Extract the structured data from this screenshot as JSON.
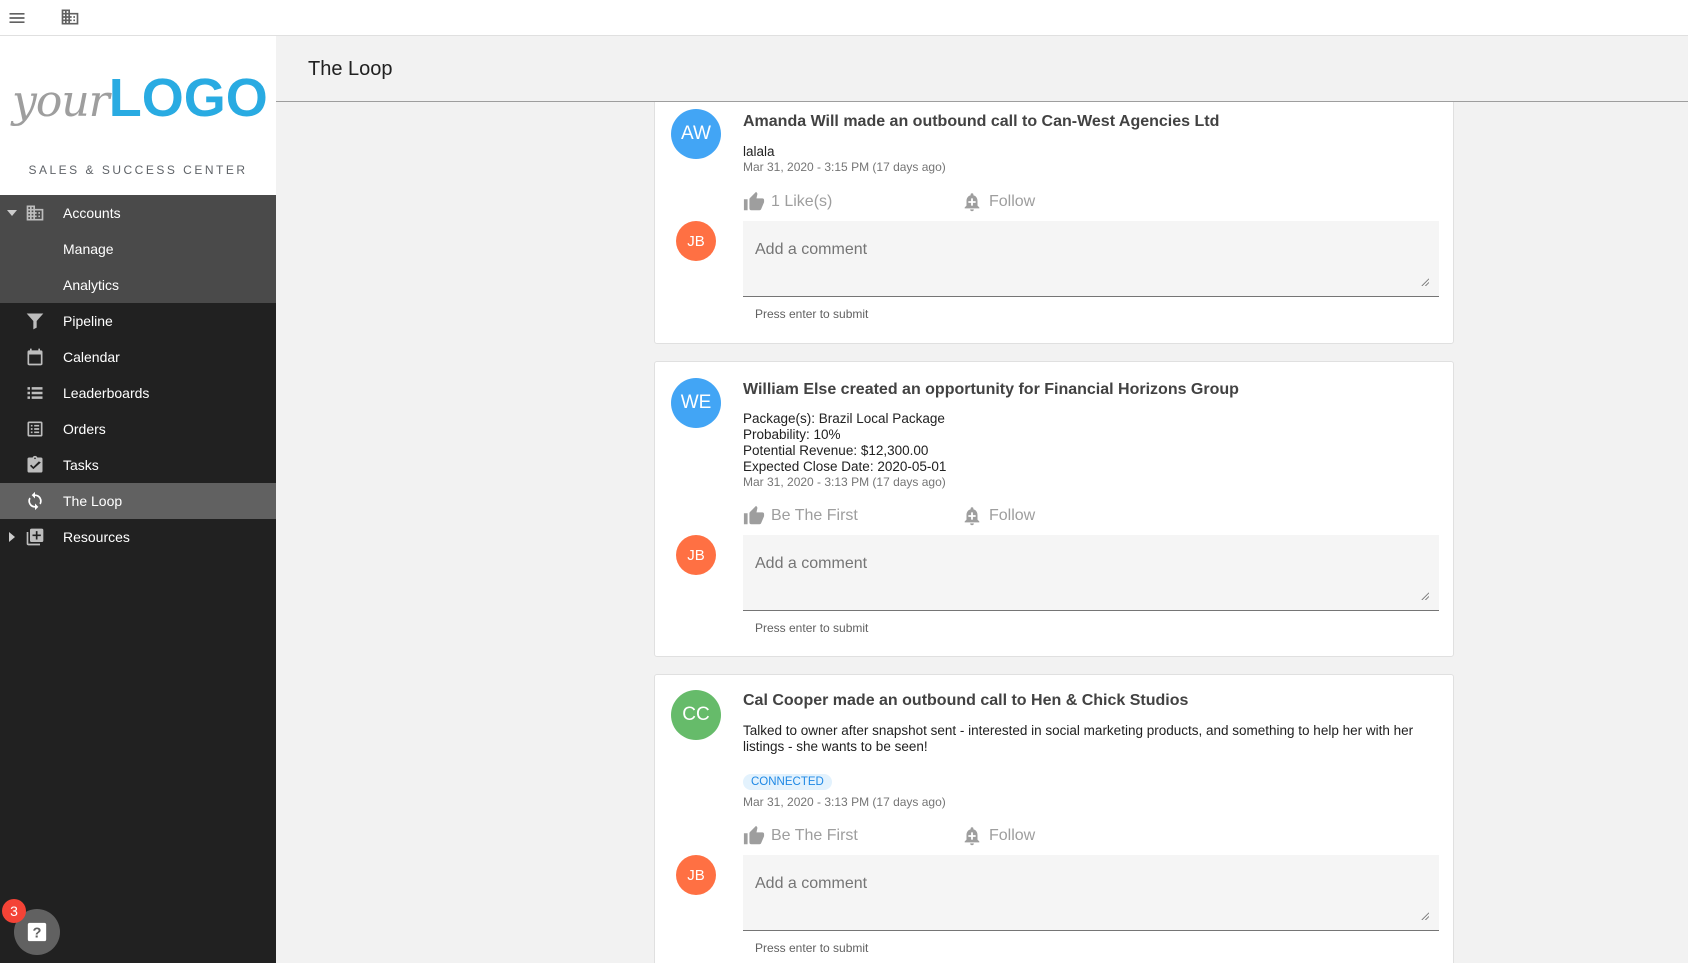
{
  "app": {
    "logo_your": "your",
    "logo_logo": "LOGO",
    "tagline": "SALES & SUCCESS CENTER"
  },
  "sidebar": {
    "items": [
      {
        "label": "Accounts",
        "icon": "building-icon"
      },
      {
        "label": "Manage"
      },
      {
        "label": "Analytics"
      },
      {
        "label": "Pipeline",
        "icon": "funnel-icon"
      },
      {
        "label": "Calendar",
        "icon": "calendar-icon"
      },
      {
        "label": "Leaderboards",
        "icon": "list-icon"
      },
      {
        "label": "Orders",
        "icon": "orders-icon"
      },
      {
        "label": "Tasks",
        "icon": "clipboard-check-icon"
      },
      {
        "label": "The Loop",
        "icon": "sync-icon"
      },
      {
        "label": "Resources",
        "icon": "library-icon"
      }
    ]
  },
  "help": {
    "badge": "3"
  },
  "header": {
    "title": "The Loop"
  },
  "feed": {
    "comment_placeholder": "Add a comment",
    "comment_hint": "Press enter to submit",
    "follow_label": "Follow",
    "commenter_initials": "JB",
    "posts": [
      {
        "initials": "AW",
        "avatar_color": "#42a5f5",
        "title": "Amanda Will made an outbound call to Can-West Agencies Ltd",
        "body": [
          "lalala"
        ],
        "timestamp": "Mar 31, 2020 - 3:15 PM (17 days ago)",
        "like_label": "1 Like(s)"
      },
      {
        "initials": "WE",
        "avatar_color": "#42a5f5",
        "title": "William Else created an opportunity for Financial Horizons Group",
        "body": [
          "Package(s): Brazil Local Package",
          "Probability: 10%",
          "Potential Revenue: $12,300.00",
          "Expected Close Date: 2020-05-01"
        ],
        "timestamp": "Mar 31, 2020 - 3:13 PM (17 days ago)",
        "like_label": "Be The First"
      },
      {
        "initials": "CC",
        "avatar_color": "#66bb6a",
        "title": "Cal Cooper made an outbound call to Hen & Chick Studios",
        "body": [
          "Talked to owner after snapshot sent - interested in social marketing products, and something to help her with her listings - she wants to be seen!"
        ],
        "tag": "CONNECTED",
        "timestamp": "Mar 31, 2020 - 3:13 PM (17 days ago)",
        "like_label": "Be The First"
      }
    ]
  },
  "colors": {
    "sidebar_bg": "#212121",
    "sidebar_expanded": "#4a4a4a",
    "sidebar_active": "#616161",
    "logo_blue": "#29abe2",
    "commenter_avatar": "#ff7043",
    "badge_red": "#f44336"
  }
}
